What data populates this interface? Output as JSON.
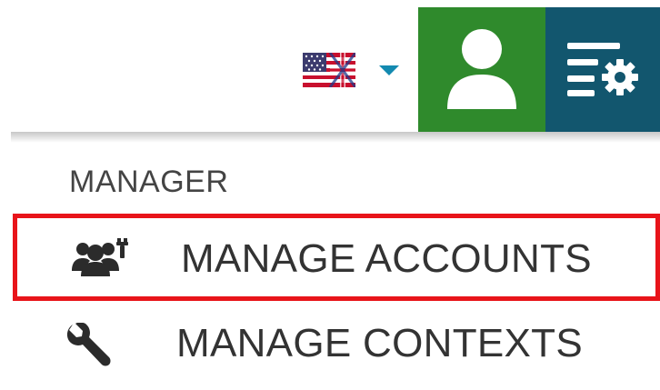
{
  "header": {
    "language": {
      "flag_icon": "flag-icon",
      "dropdown_icon": "caret-down-icon",
      "caret_color": "#138ab0"
    },
    "user_button": {
      "icon": "user-icon",
      "color": "#2f8a2c"
    },
    "settings_button": {
      "icon": "settings-menu-icon",
      "color": "#12566e"
    }
  },
  "menu": {
    "section_title": "MANAGER",
    "items": [
      {
        "label": "MANAGE ACCOUNTS",
        "icon": "users-settings-icon",
        "highlighted": true,
        "highlight_color": "#e8141a"
      },
      {
        "label": "MANAGE CONTEXTS",
        "icon": "wrench-icon",
        "highlighted": false
      }
    ]
  }
}
